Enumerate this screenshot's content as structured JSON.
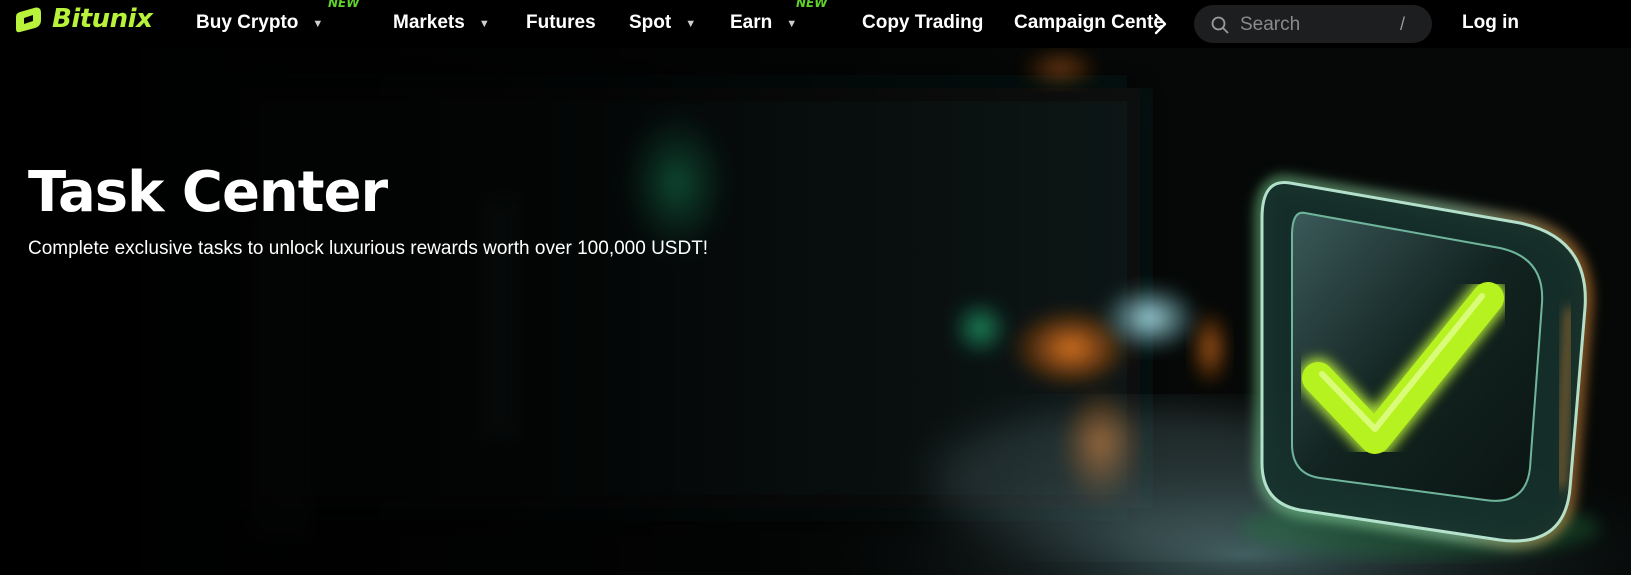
{
  "brand": {
    "name": "Bitunix",
    "logo_color": "#b8f23a"
  },
  "nav": {
    "buy_crypto": "Buy Crypto",
    "buy_crypto_badge": "NEW",
    "markets": "Markets",
    "futures": "Futures",
    "spot": "Spot",
    "earn": "Earn",
    "earn_badge": "NEW",
    "copy_trading": "Copy Trading",
    "campaign_center": "Campaign Center",
    "caret_icon": "chevron-down-icon",
    "next_icon": "chevron-right-icon"
  },
  "search": {
    "placeholder": "Search",
    "shortcut": "/"
  },
  "auth": {
    "login": "Log in"
  },
  "hero": {
    "title": "Task Center",
    "subtitle": "Complete exclusive tasks to unlock luxurious rewards worth over 100,000 USDT!",
    "art_icon": "glowing-checkmark-icon"
  },
  "colors": {
    "accent": "#b8f23a",
    "badge": "#5fd12a",
    "background": "#000000"
  }
}
